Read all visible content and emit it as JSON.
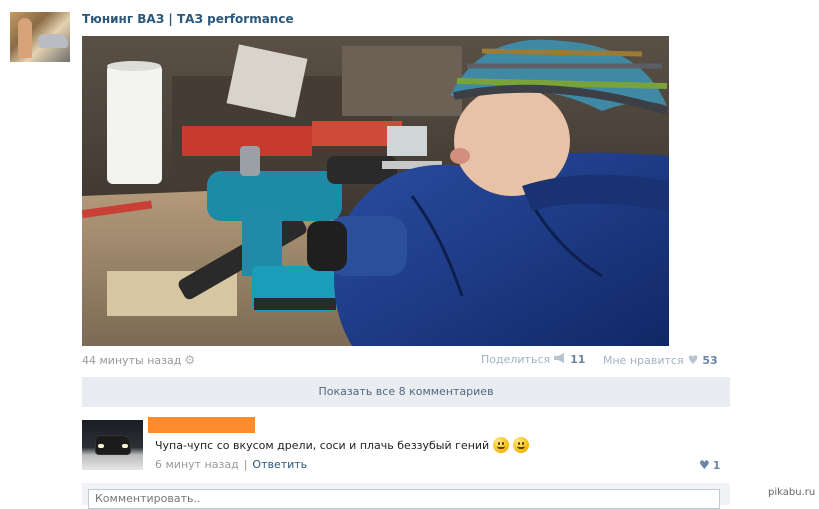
{
  "post": {
    "group_name": "Тюнинг ВАЗ | ТАЗ performance",
    "time": "44 минуты назад",
    "share_label": "Поделиться",
    "share_count": "11",
    "like_label": "Мне нравится",
    "like_count": "53",
    "show_comments_label": "Показать все 8 комментариев"
  },
  "comment": {
    "text": "Чупа-чупс со вкусом дрели, соси и плачь беззубый гений",
    "time": "6 минут назад",
    "separator": "|",
    "reply_label": "Ответить",
    "like_count": "1"
  },
  "comment_input": {
    "placeholder": "Комментировать.."
  },
  "watermark": "pikabu.ru",
  "icons": {
    "settings": "gear-icon",
    "share": "megaphone-icon",
    "like": "heart-icon"
  },
  "colors": {
    "link": "#2b587a",
    "accent_count": "#6a85a5",
    "redacted_name": "#ff8b2a",
    "show_comments_bg": "#e9edf1"
  }
}
